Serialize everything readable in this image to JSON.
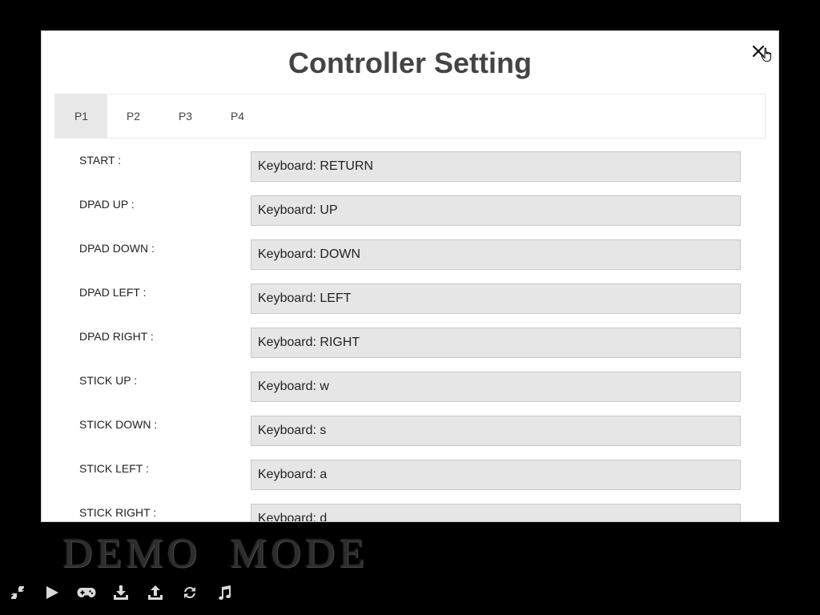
{
  "modal": {
    "title": "Controller Setting",
    "tabs": [
      {
        "label": "P1",
        "active": true
      },
      {
        "label": "P2",
        "active": false
      },
      {
        "label": "P3",
        "active": false
      },
      {
        "label": "P4",
        "active": false
      }
    ],
    "mappings": [
      {
        "label": "START :",
        "value": "Keyboard: RETURN"
      },
      {
        "label": "DPAD UP :",
        "value": "Keyboard: UP"
      },
      {
        "label": "DPAD DOWN :",
        "value": "Keyboard: DOWN"
      },
      {
        "label": "DPAD LEFT :",
        "value": "Keyboard: LEFT"
      },
      {
        "label": "DPAD RIGHT :",
        "value": "Keyboard: RIGHT"
      },
      {
        "label": "STICK UP :",
        "value": "Keyboard: w"
      },
      {
        "label": "STICK DOWN :",
        "value": "Keyboard: s"
      },
      {
        "label": "STICK LEFT :",
        "value": "Keyboard: a"
      },
      {
        "label": "STICK RIGHT :",
        "value": "Keyboard: d"
      }
    ]
  },
  "background": {
    "demo_text": "DEMO  MODE"
  },
  "toolbar": {
    "icons": [
      "shrink-icon",
      "play-icon",
      "gamepad-icon",
      "download-icon",
      "upload-icon",
      "refresh-icon",
      "music-icon"
    ]
  },
  "colors": {
    "background": "#000000",
    "modal": "#ffffff",
    "field": "#e6e6e6",
    "active_tab": "#e8e8e8",
    "title": "#444444",
    "toolbar_icon": "#d9d9d9"
  }
}
